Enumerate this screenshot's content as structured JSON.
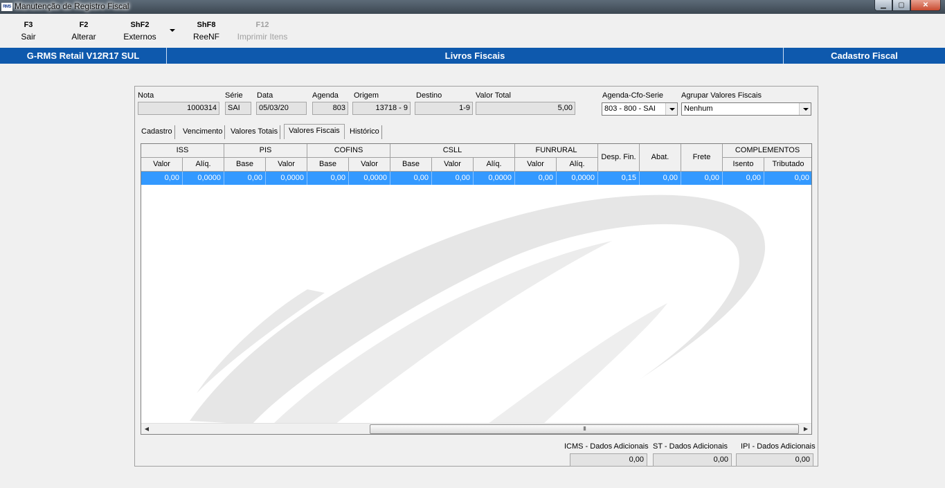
{
  "window": {
    "title": "Manutenção de Registro Fiscal",
    "icon_text": "RMS",
    "buttons": {
      "minimize": "▁",
      "maximize": "▢",
      "close": "✕"
    }
  },
  "toolbar": {
    "items": [
      {
        "key": "F3",
        "label": "Sair",
        "enabled": true
      },
      {
        "key": "F2",
        "label": "Alterar",
        "enabled": true
      },
      {
        "key": "ShF2",
        "label": "Externos",
        "enabled": true
      },
      {
        "key": "ShF8",
        "label": "ReeNF",
        "enabled": true
      },
      {
        "key": "F12",
        "label": "Imprimir Itens",
        "enabled": false
      }
    ]
  },
  "header": {
    "left": "G-RMS Retail V12R17 SUL",
    "center": "Livros Fiscais",
    "right": "Cadastro Fiscal",
    "color": "#0e59ad"
  },
  "form": {
    "nota": {
      "label": "Nota",
      "value": "1000314"
    },
    "serie": {
      "label": "Série",
      "value": "SAI"
    },
    "data": {
      "label": "Data",
      "value": "05/03/20"
    },
    "agenda": {
      "label": "Agenda",
      "value": "803"
    },
    "origem": {
      "label": "Origem",
      "value": "13718 - 9"
    },
    "destino": {
      "label": "Destino",
      "value": "1-9"
    },
    "valor_total": {
      "label": "Valor Total",
      "value": "5,00"
    },
    "agenda_cfo_serie": {
      "label": "Agenda-Cfo-Serie",
      "value": "803 - 800 - SAI"
    },
    "agrupar": {
      "label": "Agrupar Valores Fiscais",
      "value": "Nenhum"
    }
  },
  "tabs": [
    {
      "label": "Cadastro"
    },
    {
      "label": "Vencimento"
    },
    {
      "label": "Valores Totais"
    },
    {
      "label": "Valores Fiscais",
      "active": true
    },
    {
      "label": "Histórico"
    }
  ],
  "grid": {
    "groups": [
      "ISS",
      "PIS",
      "COFINS",
      "CSLL",
      "FUNRURAL",
      "Desp. Fin.",
      "Abat.",
      "Frete",
      "COMPLEMENTOS"
    ],
    "subheaders": [
      "Valor",
      "Alíq.",
      "Base",
      "Valor",
      "Base",
      "Valor",
      "Base",
      "Valor",
      "Alíq.",
      "Valor",
      "Alíq.",
      "Isento",
      "Tributado"
    ],
    "row": [
      "0,00",
      "0,0000",
      "0,00",
      "0,0000",
      "0,00",
      "0,0000",
      "0,00",
      "0,00",
      "0,0000",
      "0,00",
      "0,0000",
      "0,15",
      "0,00",
      "0,00",
      "0,00",
      "0,00"
    ],
    "selection_color": "#3399ff",
    "scroll_grip": "III"
  },
  "additional": [
    {
      "label": "ICMS - Dados Adicionais",
      "value": "0,00"
    },
    {
      "label": "ST - Dados Adicionais",
      "value": "0,00"
    },
    {
      "label": "IPI - Dados Adicionais",
      "value": "0,00"
    }
  ]
}
